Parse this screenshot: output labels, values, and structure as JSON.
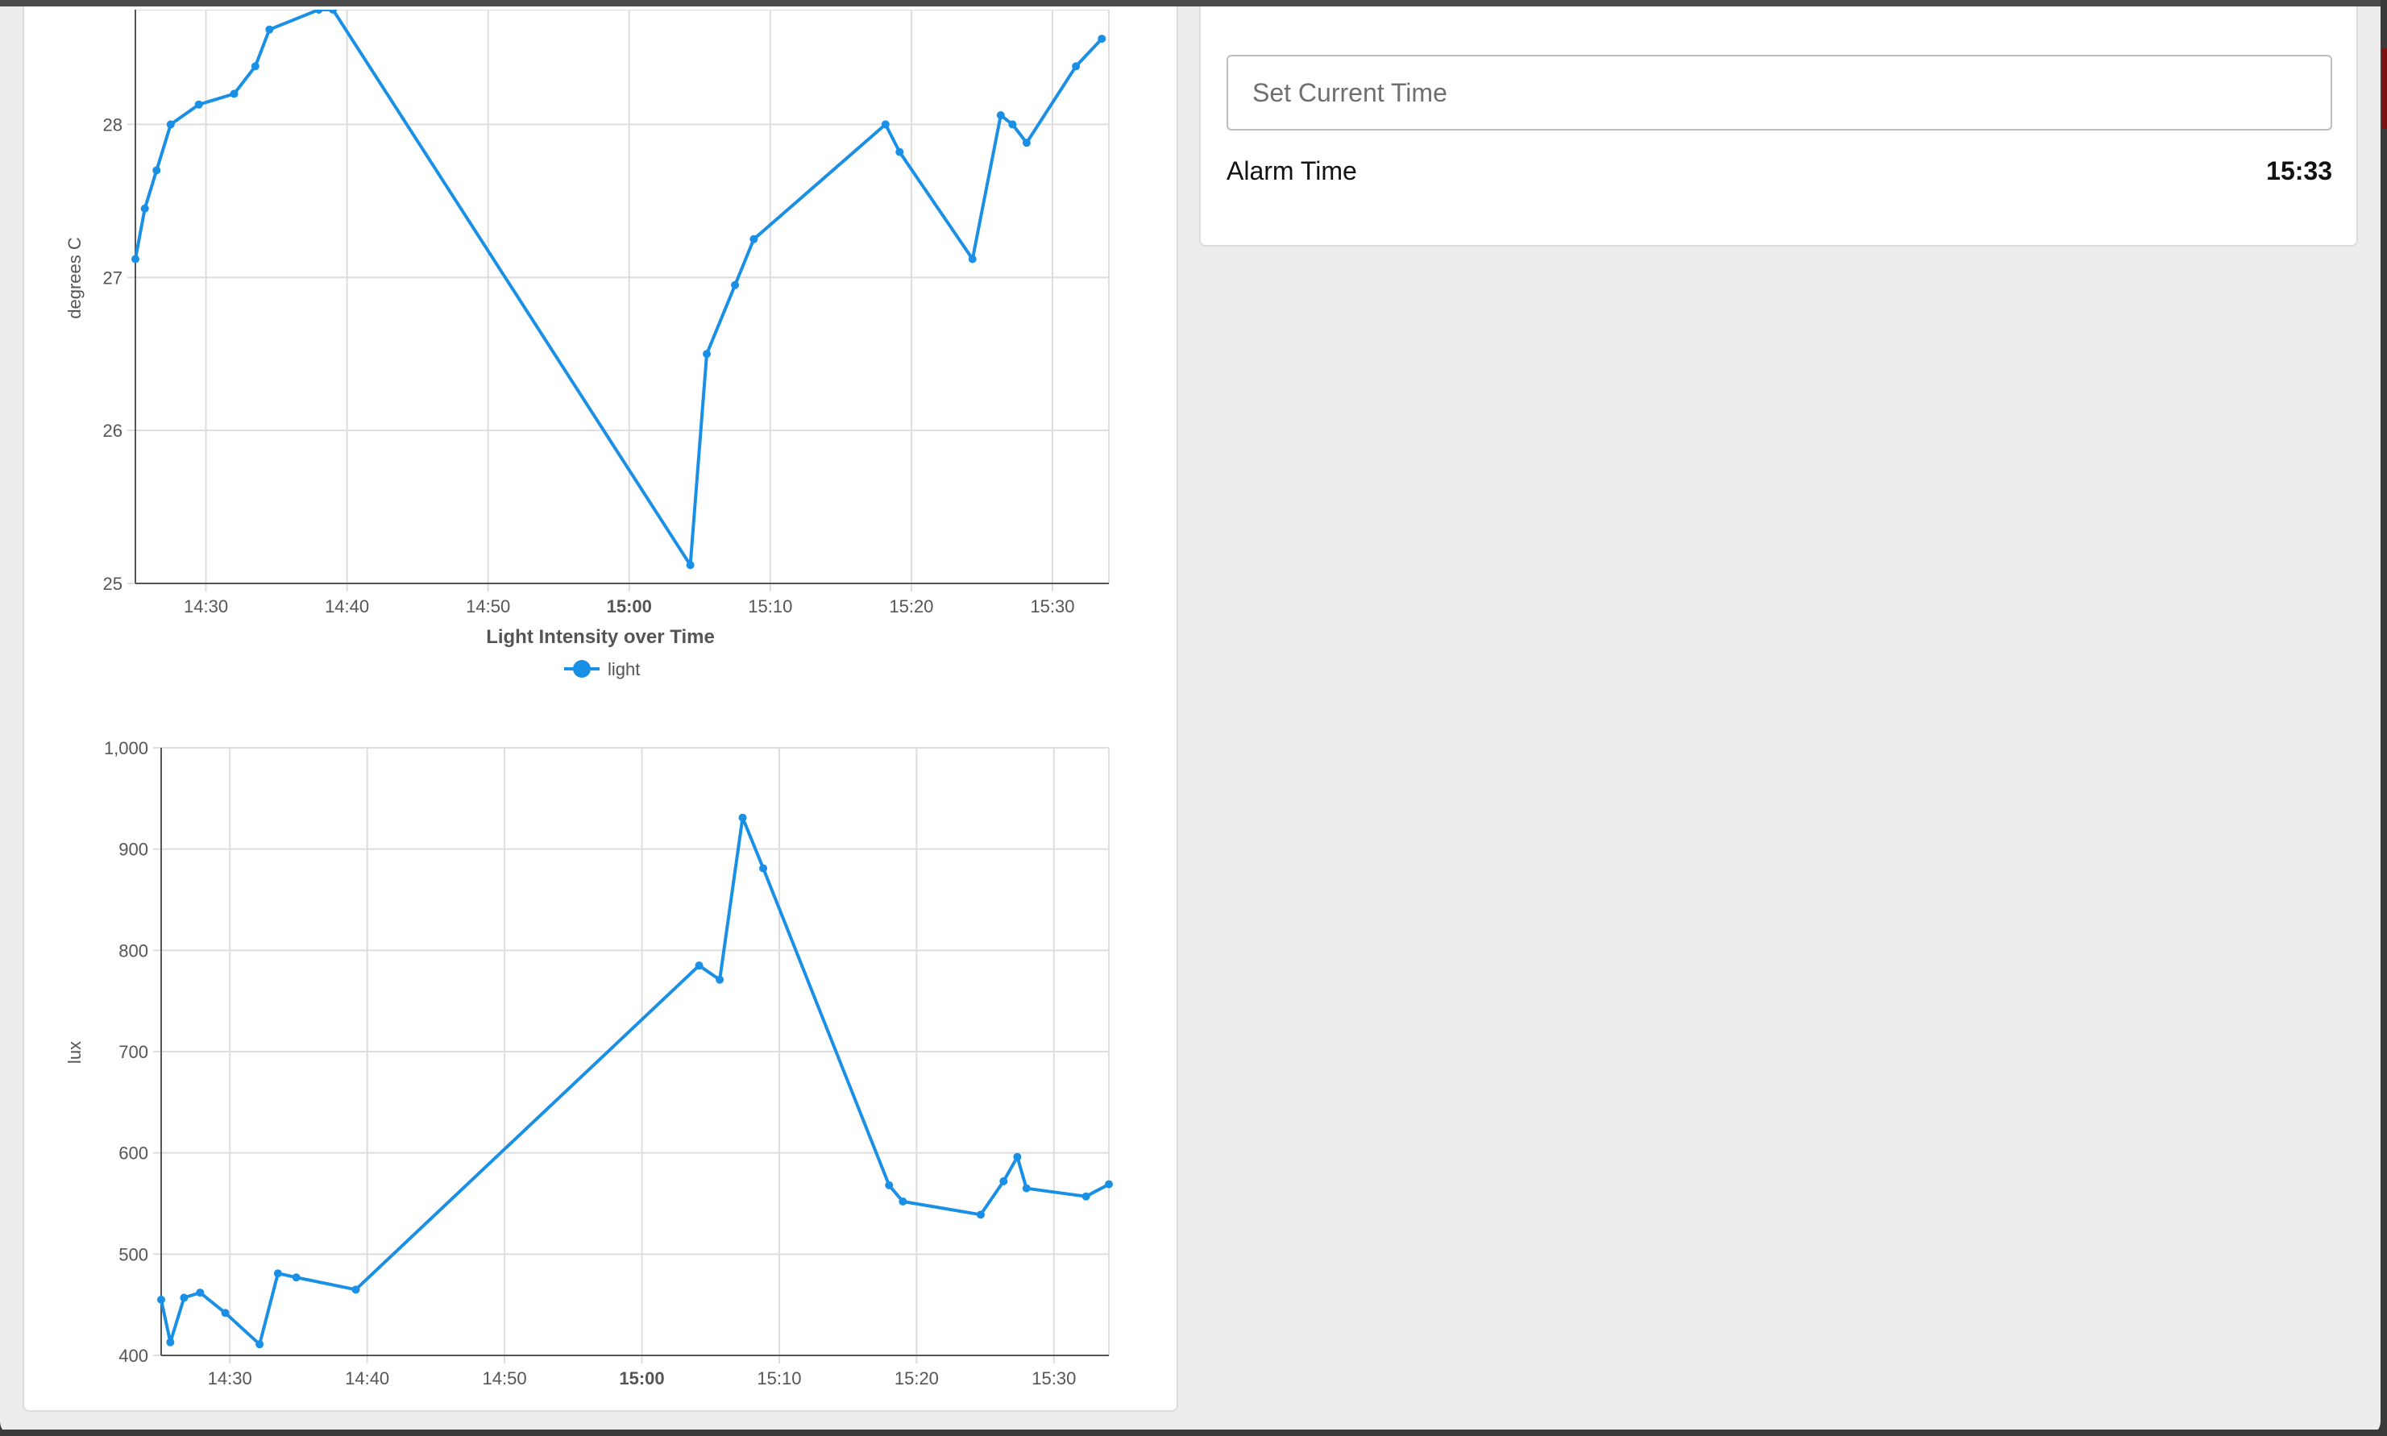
{
  "controls": {
    "set_time_placeholder": "Set Current Time",
    "alarm_label": "Alarm Time",
    "alarm_value": "15:33"
  },
  "colors": {
    "series": "#1a8fe6",
    "grid": "#dddddd",
    "axis": "#555555"
  },
  "chart_data": [
    {
      "type": "line",
      "title": "",
      "ylabel": "degrees C",
      "xlabel": "",
      "legend": "",
      "ylim": [
        25,
        28.75
      ],
      "xlim": [
        "14:25",
        "15:34"
      ],
      "x_ticks": [
        "14:30",
        "14:40",
        "14:50",
        "15:00",
        "15:10",
        "15:20",
        "15:30"
      ],
      "x_tick_bold": "15:00",
      "y_ticks": [
        25,
        26,
        27,
        28
      ],
      "grid": true,
      "series": [
        {
          "x": [
            "14:25",
            "14:25:40",
            "14:26:30",
            "14:27:30",
            "14:29:30",
            "14:32",
            "14:33:30",
            "14:34:30",
            "14:38",
            "14:39",
            "15:04:20",
            "15:05:30",
            "15:07:30",
            "15:08:50",
            "15:18:10",
            "15:19:10",
            "15:24:20",
            "15:26:20",
            "15:27:10",
            "15:28:10",
            "15:31:40",
            "15:33:30"
          ],
          "values": [
            27.12,
            27.45,
            27.7,
            28.0,
            28.13,
            28.2,
            28.38,
            28.62,
            28.75,
            28.75,
            25.12,
            26.5,
            26.95,
            27.25,
            28.0,
            27.82,
            27.12,
            28.06,
            28.0,
            27.88,
            28.38,
            28.56
          ]
        }
      ]
    },
    {
      "type": "line",
      "title": "Light Intensity over Time",
      "ylabel": "lux",
      "xlabel": "",
      "legend": "light",
      "legend_position": "top-center",
      "ylim": [
        400,
        1000
      ],
      "xlim": [
        "14:25",
        "15:34"
      ],
      "x_ticks": [
        "14:30",
        "14:40",
        "14:50",
        "15:00",
        "15:10",
        "15:20",
        "15:30"
      ],
      "x_tick_bold": "15:00",
      "y_ticks": [
        "400",
        "500",
        "600",
        "700",
        "800",
        "900",
        "1,000"
      ],
      "grid": true,
      "series": [
        {
          "name": "light",
          "x": [
            "14:25",
            "14:25:40",
            "14:26:40",
            "14:27:50",
            "14:29:40",
            "14:32:10",
            "14:33:30",
            "14:34:50",
            "14:39:10",
            "15:04:10",
            "15:05:40",
            "15:07:20",
            "15:08:50",
            "15:18:00",
            "15:19:00",
            "15:24:40",
            "15:26:20",
            "15:27:20",
            "15:28:00",
            "15:32:20",
            "15:34"
          ],
          "values": [
            455,
            413,
            457,
            462,
            442,
            411,
            481,
            477,
            465,
            785,
            771,
            931,
            881,
            568,
            552,
            539,
            572,
            596,
            565,
            557,
            569
          ]
        }
      ]
    }
  ]
}
